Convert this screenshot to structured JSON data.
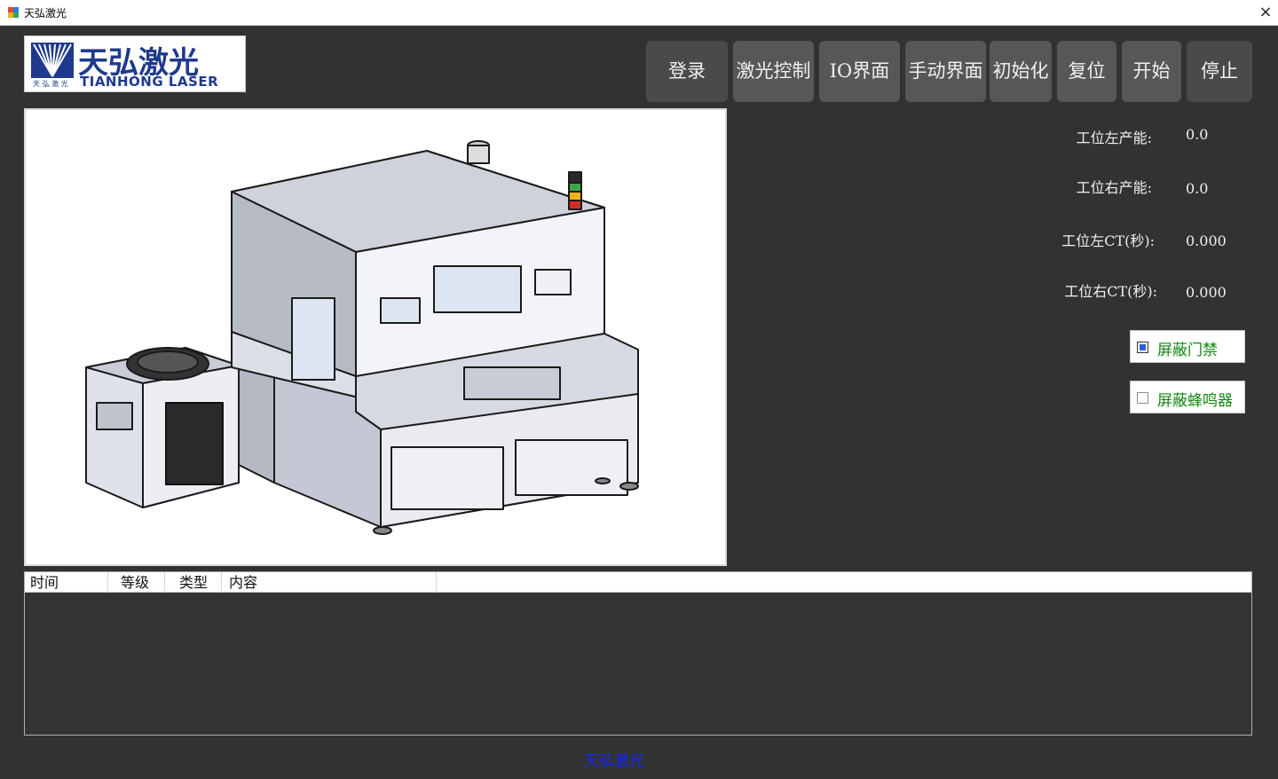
{
  "window": {
    "title": "天弘激光",
    "close": "×"
  },
  "logo": {
    "cn": "天弘激光",
    "cn_small": "天 弘 激 光",
    "en": "TIANHONG LASER",
    "brand_color": "#1f3a8c"
  },
  "toolbar": {
    "login": "登录",
    "laser_control": "激光控制",
    "io": "IO界面",
    "manual": "手动界面",
    "init": "初始化",
    "reset": "复位",
    "start": "开始",
    "stop": "停止"
  },
  "stats": {
    "left_capacity": {
      "label": "工位左产能:",
      "value": "0.0"
    },
    "right_capacity": {
      "label": "工位右产能:",
      "value": "0.0"
    },
    "left_ct": {
      "label": "工位左CT(秒):",
      "value": "0.000"
    },
    "right_ct": {
      "label": "工位右CT(秒):",
      "value": "0.000"
    }
  },
  "options": {
    "door": {
      "label": "屏蔽门禁",
      "checked": true
    },
    "buzzer": {
      "label": "屏蔽蜂鸣器",
      "checked": false
    }
  },
  "log": {
    "columns": [
      "时间",
      "等级",
      "类型",
      "内容"
    ]
  },
  "footer": {
    "text": "天弘激光",
    "color": "#1428ff"
  }
}
